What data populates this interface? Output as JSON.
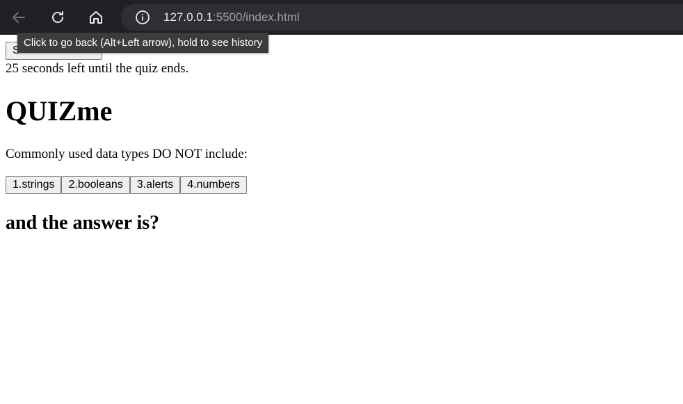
{
  "browser": {
    "url_host": "127.0.0.1",
    "url_rest": ":5500/index.html",
    "tooltip": "Click to go back (Alt+Left arrow), hold to see history",
    "icons": {
      "back": "back-arrow-icon",
      "reload": "reload-icon",
      "home": "home-icon",
      "info": "info-icon"
    },
    "colors": {
      "toolbar_bg": "#202124",
      "address_bg": "#2e2f32",
      "tooltip_bg": "#3c3c3c"
    }
  },
  "quiz": {
    "start_button": "S",
    "timer_text": "25 seconds left until the quiz ends.",
    "title": "QUIZme",
    "question": "Commonly used data types DO NOT include:",
    "answers": [
      "1.strings",
      "2.booleans",
      "3.alerts",
      "4.numbers"
    ],
    "answer_heading": "and the answer is?"
  }
}
